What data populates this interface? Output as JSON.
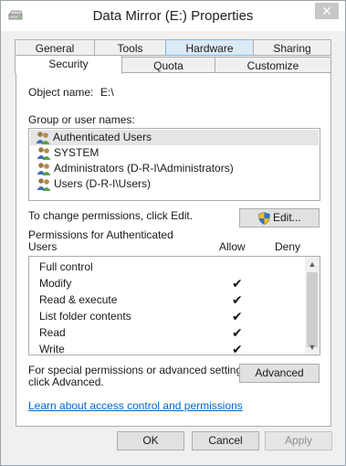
{
  "window": {
    "title": "Data Mirror (E:) Properties",
    "close_glyph": "✕",
    "title_icon": "drive-icon"
  },
  "tabs": {
    "row1": [
      "General",
      "Tools",
      "Hardware",
      "Sharing"
    ],
    "row2": [
      "Security",
      "Quota",
      "Customize"
    ],
    "active": "Security",
    "hovered": "Hardware"
  },
  "security": {
    "object_name_label": "Object name:",
    "object_name_value": "E:\\",
    "groups_label": "Group or user names:",
    "groups": [
      {
        "name": "Authenticated Users",
        "selected": true
      },
      {
        "name": "SYSTEM",
        "selected": false
      },
      {
        "name": "Administrators (D-R-I\\Administrators)",
        "selected": false
      },
      {
        "name": "Users (D-R-I\\Users)",
        "selected": false
      }
    ],
    "change_hint": "To change permissions, click Edit.",
    "edit_button": "Edit...",
    "permissions_for_line1": "Permissions for Authenticated",
    "permissions_for_line2": "Users",
    "allow_header": "Allow",
    "deny_header": "Deny",
    "permissions": [
      {
        "name": "Full control",
        "allow": false,
        "deny": false
      },
      {
        "name": "Modify",
        "allow": true,
        "deny": false
      },
      {
        "name": "Read & execute",
        "allow": true,
        "deny": false
      },
      {
        "name": "List folder contents",
        "allow": true,
        "deny": false
      },
      {
        "name": "Read",
        "allow": true,
        "deny": false
      },
      {
        "name": "Write",
        "allow": true,
        "deny": false
      }
    ],
    "check_glyph": "✔",
    "special_hint_line1": "For special permissions or advanced settings,",
    "special_hint_line2": "click Advanced.",
    "advanced_button": "Advanced",
    "learn_link": "Learn about access control and permissions"
  },
  "footer": {
    "ok": "OK",
    "cancel": "Cancel",
    "apply": "Apply"
  },
  "colors": {
    "link": "#0066cc",
    "hover_tab": "#dce9f6",
    "selected_row": "#e5e5e5"
  }
}
